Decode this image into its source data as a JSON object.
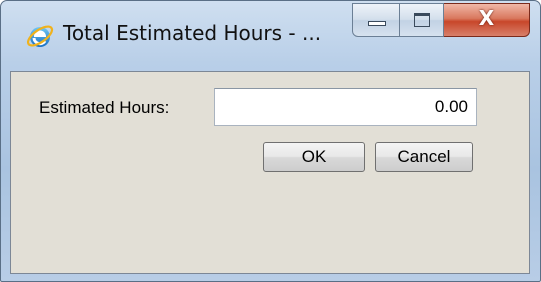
{
  "window": {
    "title": "Total Estimated Hours - ...",
    "icon": "internet-explorer-icon",
    "caption_buttons": {
      "minimize": "minimize-icon",
      "maximize": "maximize-icon",
      "close": "close-icon",
      "close_glyph": "X"
    }
  },
  "form": {
    "hours_label": "Estimated Hours:",
    "hours_value": "0.00",
    "ok_label": "OK",
    "cancel_label": "Cancel"
  },
  "colors": {
    "titlebar": "#b9cfe8",
    "client_background": "#e2dfd6",
    "close_button": "#c8462a"
  }
}
